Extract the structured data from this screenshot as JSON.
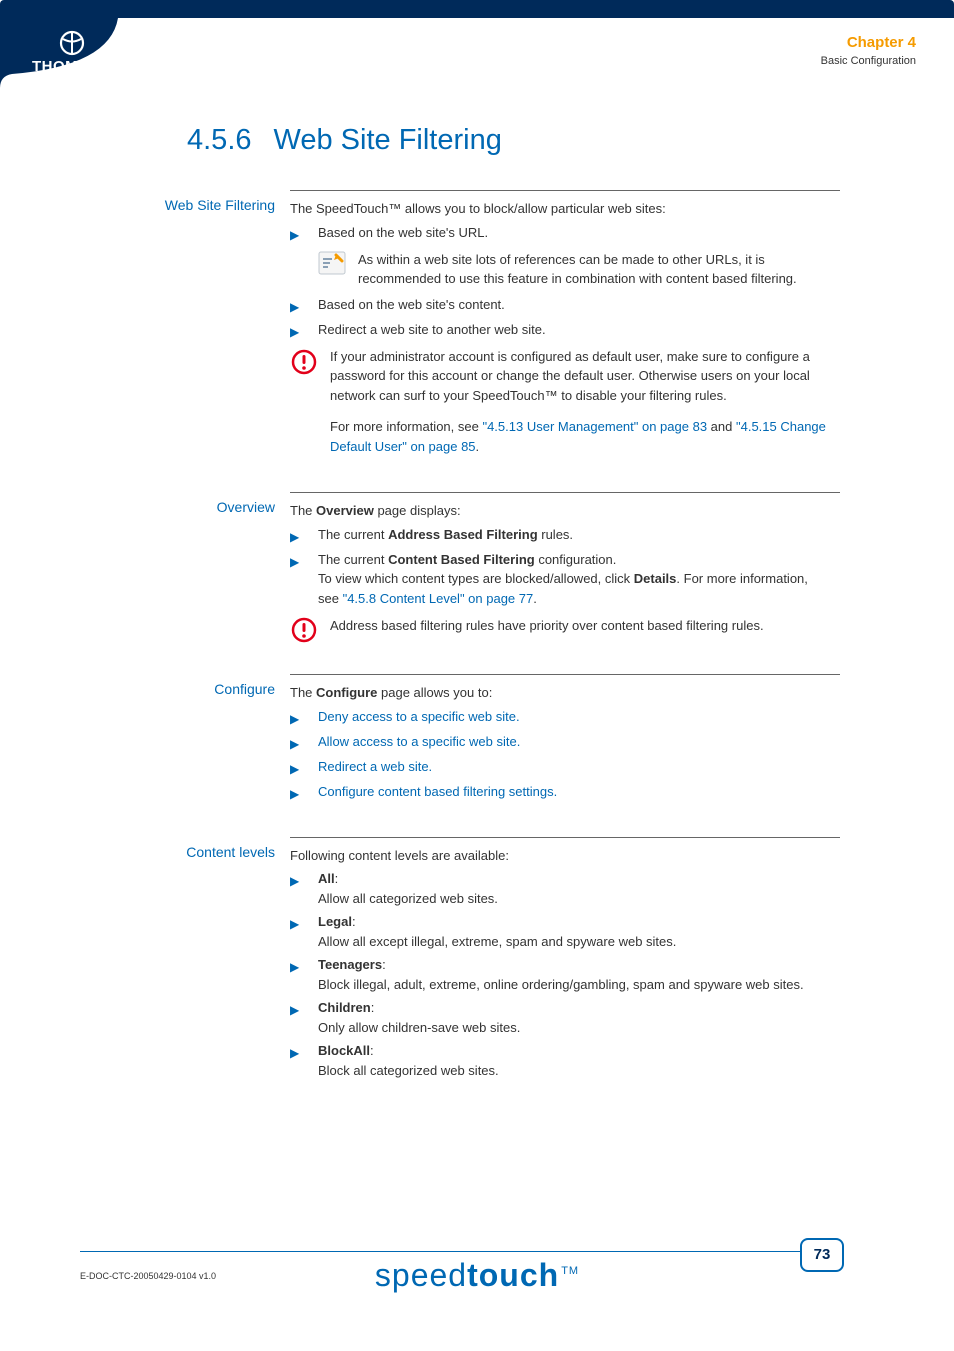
{
  "header": {
    "brand": "THOMSON",
    "chapter_title": "Chapter 4",
    "chapter_sub": "Basic Configuration"
  },
  "section": {
    "number": "4.5.6",
    "title": "Web Site Filtering"
  },
  "rows": {
    "filtering": {
      "label": "Web Site Filtering",
      "intro": "The SpeedTouch™ allows you to block/allow particular web sites:",
      "item1": "Based on the web site's URL.",
      "tip1": "As within a web site lots of references can be made to other URLs, it is recommended to use this feature in combination with content based filtering.",
      "item2": "Based on the web site's content.",
      "item3": "Redirect a web site to another web site.",
      "warn_body": "If your administrator account is configured as default user, make sure to configure a password for this account or change the default user. Otherwise users on your local network can surf to your SpeedTouch™ to disable your filtering rules.",
      "warn_more_pre": "For more information, see ",
      "warn_link1": "\"4.5.13 User Management\" on page 83",
      "warn_mid": " and ",
      "warn_link2": "\"4.5.15 Change Default User\" on page 85",
      "warn_end": "."
    },
    "overview": {
      "label": "Overview",
      "intro_pre": "The ",
      "intro_bold": "Overview",
      "intro_post": " page displays:",
      "item1_pre": "The current ",
      "item1_bold": "Address Based Filtering",
      "item1_post": " rules.",
      "item2_pre": "The current ",
      "item2_bold": "Content Based Filtering",
      "item2_post": " configuration.",
      "item2_line2_pre": "To view which content types are blocked/allowed, click ",
      "item2_line2_bold": "Details",
      "item2_line2_post": ". For more information, see ",
      "item2_link": "\"4.5.8 Content Level\" on page 77",
      "item2_end": ".",
      "warn": "Address based filtering rules have priority over content based filtering rules."
    },
    "configure": {
      "label": "Configure",
      "intro_pre": "The ",
      "intro_bold": "Configure",
      "intro_post": " page allows you to:",
      "i1": "Deny access to a specific web site.",
      "i2": "Allow access to a specific web site.",
      "i3": "Redirect a web site.",
      "i4": "Configure content based filtering settings."
    },
    "levels": {
      "label": "Content levels",
      "intro": "Following content levels are available:",
      "l1_name": "All",
      "l1_desc": "Allow all categorized web sites.",
      "l2_name": "Legal",
      "l2_desc": "Allow all except illegal, extreme, spam and spyware web sites.",
      "l3_name": "Teenagers",
      "l3_desc": "Block illegal, adult, extreme, online ordering/gambling, spam and spyware web sites.",
      "l4_name": "Children",
      "l4_desc": "Only allow children-save web sites.",
      "l5_name": "BlockAll",
      "l5_desc": "Block all categorized web sites."
    }
  },
  "footer": {
    "doc": "E-DOC-CTC-20050429-0104 v1.0",
    "logo_thin": "speed",
    "logo_bold": "touch",
    "tm": "TM",
    "page": "73"
  }
}
